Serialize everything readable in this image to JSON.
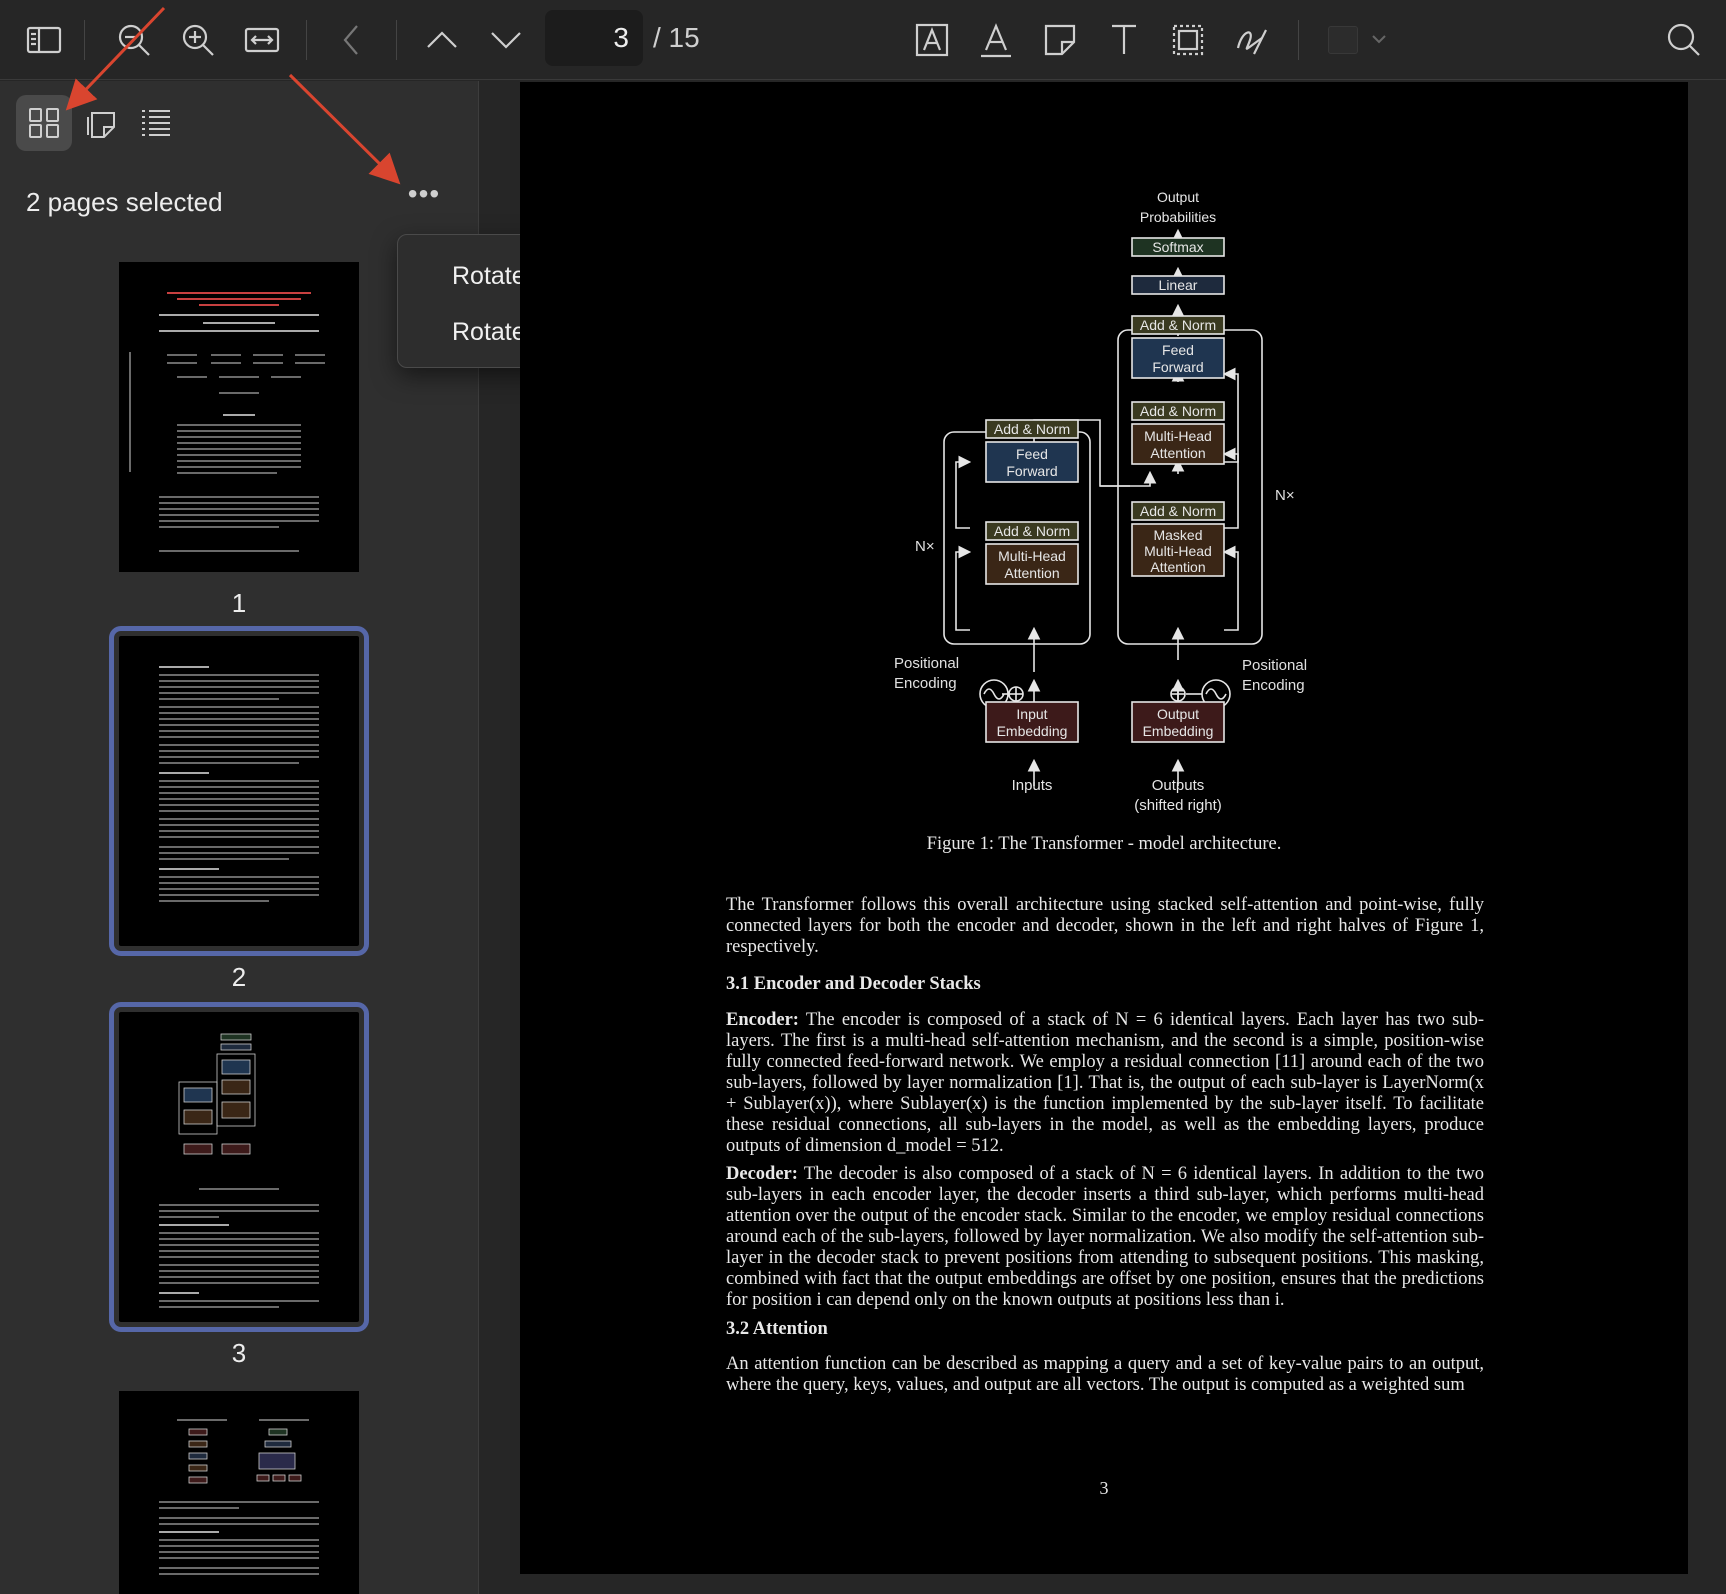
{
  "toolbar": {
    "current_page": "3",
    "page_total": "/ 15",
    "icons": [
      "sidebar-toggle-icon",
      "zoom-out-icon",
      "zoom-in-icon",
      "fit-width-icon",
      "back-icon",
      "page-up-icon",
      "page-down-icon",
      "text-box-icon",
      "text-style-icon",
      "note-icon",
      "text-tool-icon",
      "selection-icon",
      "signature-icon",
      "color-icon",
      "search-icon"
    ]
  },
  "sidebar": {
    "selection_text": "2 pages selected",
    "more_label": "•••",
    "thumbnails": [
      {
        "label": "1",
        "selected": false
      },
      {
        "label": "2",
        "selected": true
      },
      {
        "label": "3",
        "selected": true
      },
      {
        "label": "",
        "selected": false
      }
    ]
  },
  "menu": {
    "items": [
      "Rotate Left",
      "Rotate Right"
    ]
  },
  "document": {
    "diagram": {
      "output_probabilities": [
        "Output",
        "Probabilities"
      ],
      "softmax": "Softmax",
      "linear": "Linear",
      "add_norm": "Add & Norm",
      "feed_forward": [
        "Feed",
        "Forward"
      ],
      "multi_head_attention": [
        "Multi-Head",
        "Attention"
      ],
      "masked_attention": [
        "Masked",
        "Multi-Head",
        "Attention"
      ],
      "nx": "N×",
      "positional_encoding": [
        "Positional",
        "Encoding"
      ],
      "input_embedding": [
        "Input",
        "Embedding"
      ],
      "output_embedding": [
        "Output",
        "Embedding"
      ],
      "inputs": "Inputs",
      "outputs": [
        "Outputs",
        "(shifted right)"
      ]
    },
    "caption": "Figure 1: The Transformer - model architecture.",
    "intro": "The Transformer follows this overall architecture using stacked self-attention and point-wise, fully connected layers for both the encoder and decoder, shown in the left and right halves of Figure 1, respectively.",
    "section_3_1": "3.1    Encoder and Decoder Stacks",
    "encoder_label": "Encoder:",
    "encoder_text": "The encoder is composed of a stack of N = 6 identical layers. Each layer has two sub-layers. The first is a multi-head self-attention mechanism, and the second is a simple, position-wise fully connected feed-forward network. We employ a residual connection [11] around each of the two sub-layers, followed by layer normalization [1]. That is, the output of each sub-layer is LayerNorm(x + Sublayer(x)), where Sublayer(x) is the function implemented by the sub-layer itself. To facilitate these residual connections, all sub-layers in the model, as well as the embedding layers, produce outputs of dimension d_model = 512.",
    "decoder_label": "Decoder:",
    "decoder_text": "The decoder is also composed of a stack of N = 6 identical layers. In addition to the two sub-layers in each encoder layer, the decoder inserts a third sub-layer, which performs multi-head attention over the output of the encoder stack. Similar to the encoder, we employ residual connections around each of the sub-layers, followed by layer normalization. We also modify the self-attention sub-layer in the decoder stack to prevent positions from attending to subsequent positions. This masking, combined with fact that the output embeddings are offset by one position, ensures that the predictions for position i can depend only on the known outputs at positions less than i.",
    "section_3_2": "3.2    Attention",
    "attention_text": "An attention function can be described as mapping a query and a set of key-value pairs to an output, where the query, keys, values, and output are all vectors. The output is computed as a weighted sum",
    "page_number": "3"
  },
  "colors": {
    "selection_outline": "#5667a8",
    "annotation_arrow": "#d9452f",
    "ff_block": "#1f3550",
    "attn_block": "#3a2616",
    "embed_block": "#3d1a1a",
    "softmax_block": "#1e3322",
    "linear_block": "#1e2a3d"
  }
}
